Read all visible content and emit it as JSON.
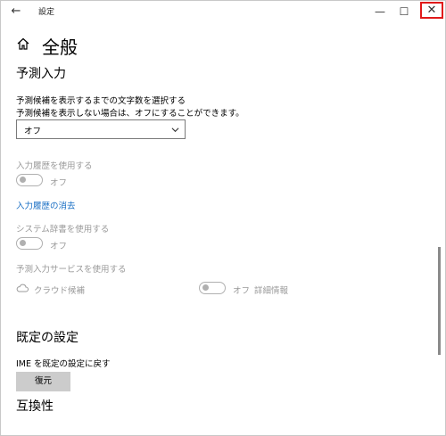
{
  "titlebar": {
    "title": "設定",
    "back_symbol": "←",
    "minimize_symbol": "—",
    "maximize_symbol": "☐",
    "close_symbol": "✕"
  },
  "header": {
    "icon": "home-icon",
    "title": "全般"
  },
  "prediction": {
    "heading": "予測入力",
    "desc_line1": "予測候補を表示するまでの文字数を選択する",
    "desc_line2": "予測候補を表示しない場合は、オフにすることができます。",
    "select_value": "オフ"
  },
  "history": {
    "label": "入力履歴を使用する",
    "toggle_text": "オフ",
    "clear_link": "入力履歴の消去"
  },
  "system_dict": {
    "label": "システム辞書を使用する",
    "toggle_text": "オフ"
  },
  "service": {
    "label": "予測入力サービスを使用する",
    "cloud_icon": "cloud-icon",
    "cloud_text": "クラウド候補",
    "toggle_text": "オフ",
    "details_text": "詳細情報"
  },
  "defaults": {
    "heading": "既定の設定",
    "desc": "IME を既定の設定に戻す",
    "button_label": "復元"
  },
  "compat": {
    "heading": "互換性"
  }
}
